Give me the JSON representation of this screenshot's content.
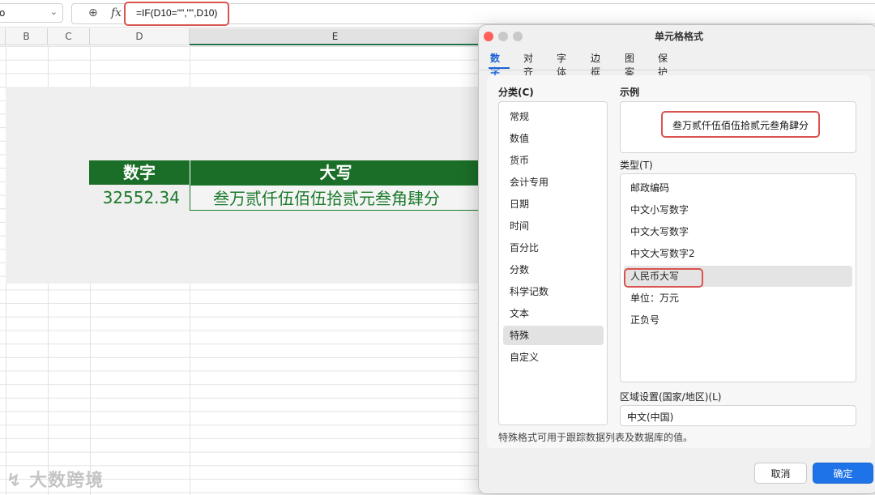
{
  "formula_bar": {
    "name_box_value": "o",
    "fx_label": "fx",
    "formula": "=IF(D10=\"\",\"\",D10)"
  },
  "sheet": {
    "columns": [
      "B",
      "C",
      "D",
      "E"
    ],
    "selected_column": "E",
    "table": {
      "header_number": "数字",
      "header_upper": "大写",
      "value_number": "32552.34",
      "value_upper": "叁万贰仟伍佰伍拾贰元叁角肆分"
    },
    "header_color": "#1b6e28",
    "text_color": "#1b7a2c"
  },
  "dialog": {
    "title": "单元格格式",
    "tabs": [
      "数字",
      "对齐",
      "字体",
      "边框",
      "图案",
      "保护"
    ],
    "active_tab": "数字",
    "category_label": "分类(C)",
    "categories": [
      "常规",
      "数值",
      "货币",
      "会计专用",
      "日期",
      "时间",
      "百分比",
      "分数",
      "科学记数",
      "文本",
      "特殊",
      "自定义"
    ],
    "selected_category": "特殊",
    "sample_label": "示例",
    "sample_value": "叁万贰仟伍佰伍拾贰元叁角肆分",
    "type_label": "类型(T)",
    "types": [
      "邮政编码",
      "中文小写数字",
      "中文大写数字",
      "中文大写数字2",
      "人民币大写",
      "单位：万元",
      "正负号"
    ],
    "selected_type": "人民币大写",
    "locale_label": "区域设置(国家/地区)(L)",
    "locale_value": "中文(中国)",
    "description": "特殊格式可用于跟踪数据列表及数据库的值。",
    "cancel_label": "取消",
    "ok_label": "确定",
    "accent_color": "#1e73e8",
    "highlight_color": "#d9534f"
  },
  "watermark": "大数跨境"
}
